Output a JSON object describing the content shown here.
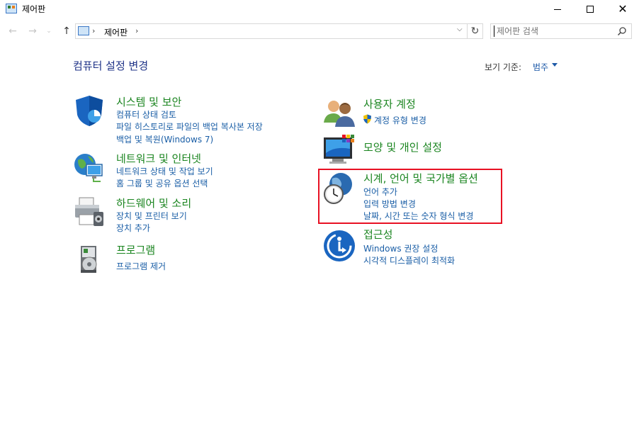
{
  "window": {
    "title": "제어판",
    "minimize_label": "minimize",
    "maximize_label": "maximize",
    "close_label": "close"
  },
  "navigation": {
    "breadcrumb": "제어판",
    "search_placeholder": "제어판 검색"
  },
  "page": {
    "heading": "컴퓨터 설정 변경",
    "view_by_label": "보기 기준:",
    "view_by_value": "범주"
  },
  "categories": {
    "system": {
      "title": "시스템 및 보안",
      "links": [
        "컴퓨터 상태 검토",
        "파일 히스토리로 파일의 백업 복사본 저장",
        "백업 및 복원(Windows 7)"
      ]
    },
    "network": {
      "title": "네트워크 및 인터넷",
      "links": [
        "네트워크 상태 및 작업 보기",
        "홈 그룹 및 공유 옵션 선택"
      ]
    },
    "hardware": {
      "title": "하드웨어 및 소리",
      "links": [
        "장치 및 프린터 보기",
        "장치 추가"
      ]
    },
    "programs": {
      "title": "프로그램",
      "links": [
        "프로그램 제거"
      ]
    },
    "users": {
      "title": "사용자 계정",
      "links": [
        "계정 유형 변경"
      ]
    },
    "appearance": {
      "title": "모양 및 개인 설정",
      "links": []
    },
    "clock": {
      "title": "시계, 언어 및 국가별 옵션",
      "links": [
        "언어 추가",
        "입력 방법 변경",
        "날짜, 시간 또는 숫자 형식 변경"
      ]
    },
    "ease": {
      "title": "접근성",
      "links": [
        "Windows 권장 설정",
        "시각적 디스플레이 최적화"
      ]
    }
  },
  "colors": {
    "category_title": "#1b8520",
    "link": "#1a5ea6",
    "heading": "#1e3287",
    "highlight_border": "#e81123"
  }
}
